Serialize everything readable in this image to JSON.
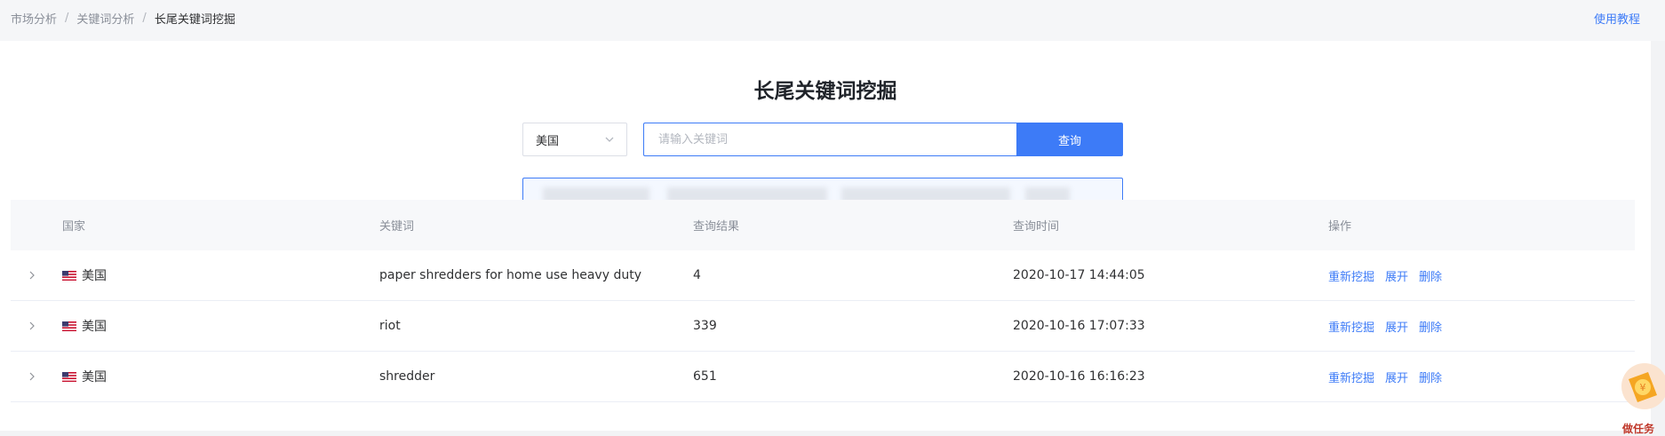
{
  "breadcrumb": {
    "items": [
      "市场分析",
      "关键词分析",
      "长尾关键词挖掘"
    ],
    "separator": "/"
  },
  "header": {
    "tutorial_link": "使用教程"
  },
  "page": {
    "title": "长尾关键词挖掘"
  },
  "search": {
    "country_selected": "美国",
    "placeholder": "请输入关键词",
    "button_label": "查询"
  },
  "table": {
    "columns": [
      "国家",
      "关键词",
      "查询结果",
      "查询时间",
      "操作"
    ],
    "rows": [
      {
        "country": "美国",
        "keyword": "paper shredders for home use heavy duty",
        "result": "4",
        "time": "2020-10-17 14:44:05"
      },
      {
        "country": "美国",
        "keyword": "riot",
        "result": "339",
        "time": "2020-10-16 17:07:33"
      },
      {
        "country": "美国",
        "keyword": "shredder",
        "result": "651",
        "time": "2020-10-16 16:16:23"
      }
    ],
    "actions": [
      "重新挖掘",
      "展开",
      "删除"
    ]
  },
  "float_widget": {
    "label": "做任务"
  },
  "colors": {
    "accent": "#3d7bf7",
    "text": "#303133",
    "muted": "#8a8f99"
  },
  "icons": [
    "chevron-down-icon",
    "expand-arrow-icon",
    "us-flag-icon",
    "task-reward-icon"
  ]
}
